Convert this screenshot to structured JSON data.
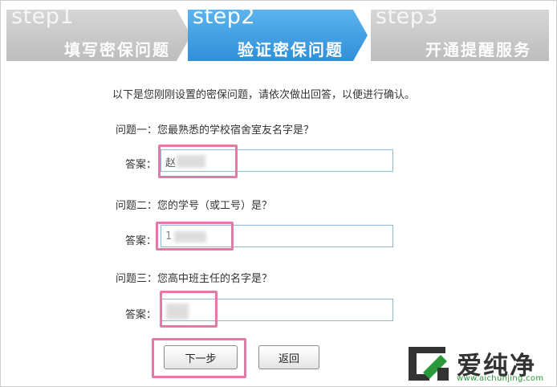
{
  "steps": [
    {
      "num": "step1",
      "label": "填写密保问题",
      "state": "done"
    },
    {
      "num": "step2",
      "label": "验证密保问题",
      "state": "active"
    },
    {
      "num": "step3",
      "label": "开通提醒服务",
      "state": "pending"
    }
  ],
  "intro": "以下是您刚刚设置的密保问题，请依次做出回答，以便进行确认。",
  "questions": [
    {
      "question": "问题一：您最熟悉的学校宿舍室友名字是？",
      "answer_label": "答案：",
      "answer_value": "赵"
    },
    {
      "question": "问题二：您的学号（或工号）是？",
      "answer_label": "答案：",
      "answer_value": "1"
    },
    {
      "question": "问题三：您高中班主任的名字是？",
      "answer_label": "答案：",
      "answer_value": ""
    }
  ],
  "buttons": {
    "next": "下一步",
    "back": "返回"
  },
  "watermark": {
    "text": "爱纯净",
    "url": "www.aichunjing.com"
  },
  "colors": {
    "active_step": "#3d9de0",
    "inactive_step": "#c9c9c9",
    "highlight": "#e07aa7",
    "input_border": "#8fb7d8"
  }
}
